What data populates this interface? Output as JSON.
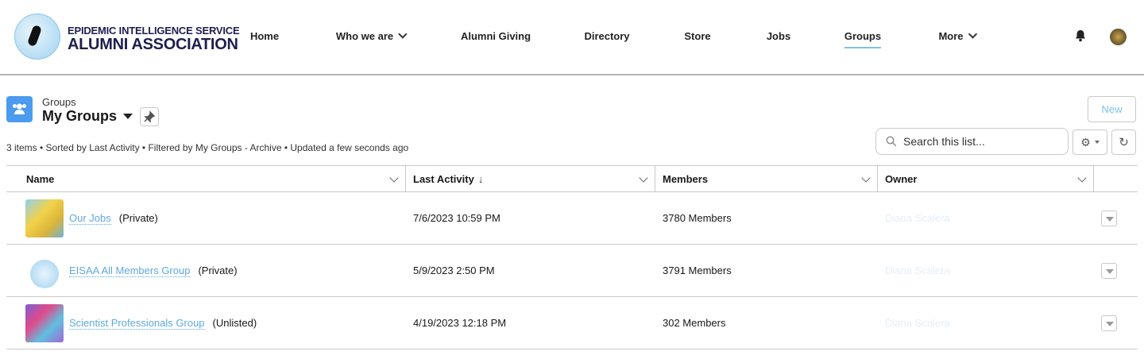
{
  "header": {
    "logo": {
      "line1": "EPIDEMIC INTELLIGENCE SERVICE",
      "line2": "ALUMNI ASSOCIATION"
    },
    "nav": [
      {
        "label": "Home"
      },
      {
        "label": "Who we are"
      },
      {
        "label": "Alumni Giving"
      },
      {
        "label": "Directory"
      },
      {
        "label": "Store"
      },
      {
        "label": "Jobs"
      },
      {
        "label": "Groups"
      },
      {
        "label": "More"
      }
    ]
  },
  "list": {
    "object_label": "Groups",
    "view_name": "My Groups",
    "status": "3 items • Sorted by Last Activity • Filtered by My Groups - Archive • Updated a few seconds ago",
    "new_label": "New",
    "search_placeholder": "Search this list...",
    "columns": [
      "Name",
      "Last Activity",
      "Members",
      "Owner"
    ],
    "sort_arrow": "↓",
    "rows": [
      {
        "name": "Our Jobs",
        "visibility": "(Private)",
        "last_activity": "7/6/2023 10:59 PM",
        "members": "3780 Members",
        "owner": "Diana Scalera"
      },
      {
        "name": "EISAA All Members Group",
        "visibility": "(Private)",
        "last_activity": "5/9/2023 2:50 PM",
        "members": "3791 Members",
        "owner": "Diana Scalera"
      },
      {
        "name": "Scientist Professionals Group",
        "visibility": "(Unlisted)",
        "last_activity": "4/19/2023 12:18 PM",
        "members": "302 Members",
        "owner": "Diana Scalera"
      }
    ]
  },
  "colors": {
    "brand": "#1d1f4f",
    "accent": "#5fa9df",
    "icon_bg": "#4b9bef"
  }
}
